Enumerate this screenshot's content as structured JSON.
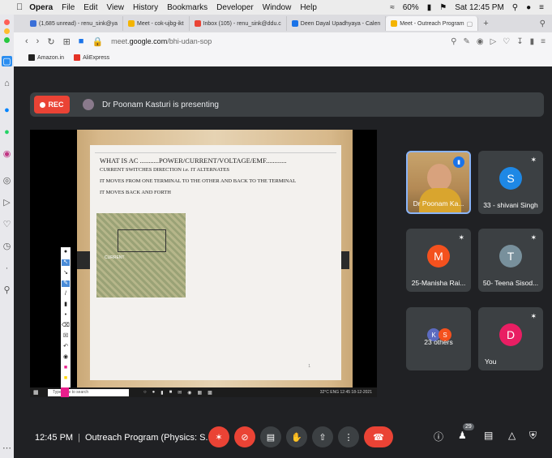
{
  "menubar": {
    "app": "Opera",
    "items": [
      "File",
      "Edit",
      "View",
      "History",
      "Bookmarks",
      "Developer",
      "Window",
      "Help"
    ],
    "battery": "60%",
    "clock": "Sat 12:45 PM"
  },
  "tabs": [
    {
      "label": "(1,685 unread) - renu_sink@ya",
      "color": "#3a6fd8"
    },
    {
      "label": "Meet - cok-ujbg-ikt",
      "color": "#f4b400"
    },
    {
      "label": "Inbox (105) - renu_sink@ddu.c",
      "color": "#ea4335"
    },
    {
      "label": "Deen Dayal Upadhyaya - Calen",
      "color": "#1a73e8"
    },
    {
      "label": "Meet - Outreach Program",
      "color": "#f4b400",
      "active": true
    }
  ],
  "address": {
    "url_prefix": "meet.",
    "url_bold": "google.com",
    "url_suffix": "/bhi-udan-sop"
  },
  "bookmarks": [
    {
      "label": "Amazon.in",
      "color": "#222"
    },
    {
      "label": "AliExpress",
      "color": "#e43225"
    }
  ],
  "meet": {
    "rec_label": "REC",
    "presenting_text": "Dr Poonam Kasturi is presenting",
    "slide": {
      "title": "WHAT IS AC ...........POWER/CURRENT/VOLTAGE/EMF............",
      "line2": "CURRENT SWITCHES DIRECTION i.e. IT ALTERNATES",
      "line3": "IT MOVES FROM ONE TERMINAL TO THE OTHER AND BACK TO THE TERMINAL",
      "line4": "IT MOVES BACK AND FORTH",
      "circuit_label": "CURRENT",
      "page": "1"
    },
    "taskbar": {
      "search_placeholder": "Type here to search",
      "system_text": "32°C  ENG  12:45  18-12-2021"
    },
    "tiles": [
      {
        "name": "Dr Poonam Ka...",
        "type": "video"
      },
      {
        "name": "33 - shivani Singh",
        "initial": "S",
        "color": "#1e88e5"
      },
      {
        "name": "25-Manisha Rai...",
        "initial": "M",
        "color": "#f4511e"
      },
      {
        "name": "50- Teena Sisod...",
        "initial": "T",
        "color": "#78909c"
      },
      {
        "name": "23 others",
        "initials": [
          "K",
          "S"
        ],
        "colors": [
          "#5c6bc0",
          "#f4511e"
        ]
      },
      {
        "name": "You",
        "initial": "D",
        "color": "#e91e63"
      }
    ],
    "bottom": {
      "time": "12:45 PM",
      "divider": "|",
      "meeting_name": "Outreach Program (Physics: S...",
      "participant_count": "29"
    }
  }
}
